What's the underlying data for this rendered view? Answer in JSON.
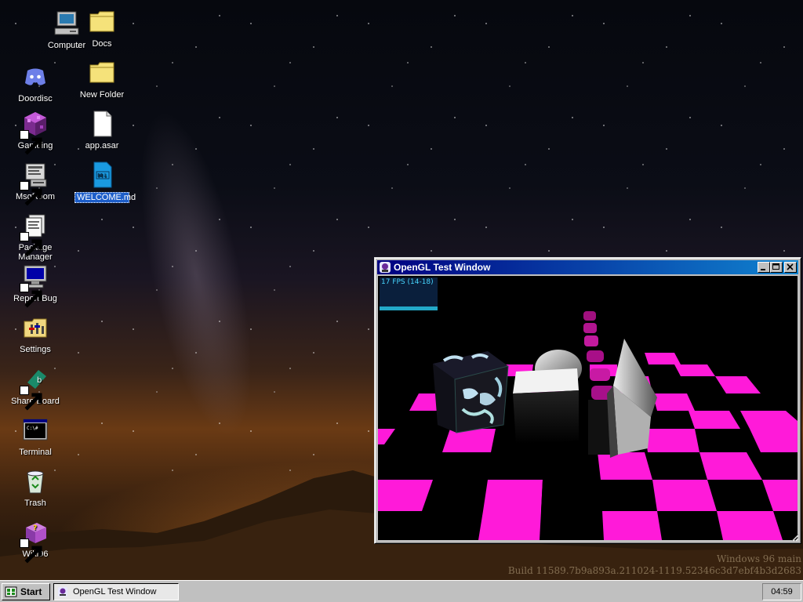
{
  "desktop": {
    "icons": [
      {
        "label": "Computer",
        "icon": "computer-icon"
      },
      {
        "label": "Docs",
        "icon": "folder-icon"
      },
      {
        "label": "Doordisc",
        "icon": "discord-icon"
      },
      {
        "label": "New Folder",
        "icon": "folder-icon"
      },
      {
        "label": "Gameing",
        "icon": "game-cube-icon"
      },
      {
        "label": "app.asar",
        "icon": "file-icon"
      },
      {
        "label": "MsgRoom",
        "icon": "msgroom-icon"
      },
      {
        "label": "WELCOME.md",
        "icon": "markdown-file-icon",
        "selected": true
      },
      {
        "label": "Package Manager",
        "icon": "package-manager-icon"
      },
      {
        "label": "Report Bug",
        "icon": "report-bug-icon"
      },
      {
        "label": "Settings",
        "icon": "settings-folder-icon"
      },
      {
        "label": "Share Board",
        "icon": "share-board-icon"
      },
      {
        "label": "Terminal",
        "icon": "terminal-icon"
      },
      {
        "label": "Trash",
        "icon": "recycle-bin-icon"
      },
      {
        "label": "Wiki96",
        "icon": "wiki-book-icon"
      }
    ]
  },
  "window": {
    "title": "OpenGL Test Window",
    "fps": "17 FPS (14-18)",
    "buttons": [
      "minimize",
      "maximize",
      "close"
    ]
  },
  "build": {
    "line1": "Windows 96 main",
    "line2": "Build 11589.7b9a893a.211024-1119.52346c3d7ebf4b3d2683"
  },
  "taskbar": {
    "start_label": "Start",
    "task_label": "OpenGL Test Window",
    "clock": "04:59"
  },
  "colors": {
    "title_start": "#000080",
    "title_end": "#1084d0",
    "checker": "#ff1ad9",
    "taskbar": "#c0c0c0"
  }
}
